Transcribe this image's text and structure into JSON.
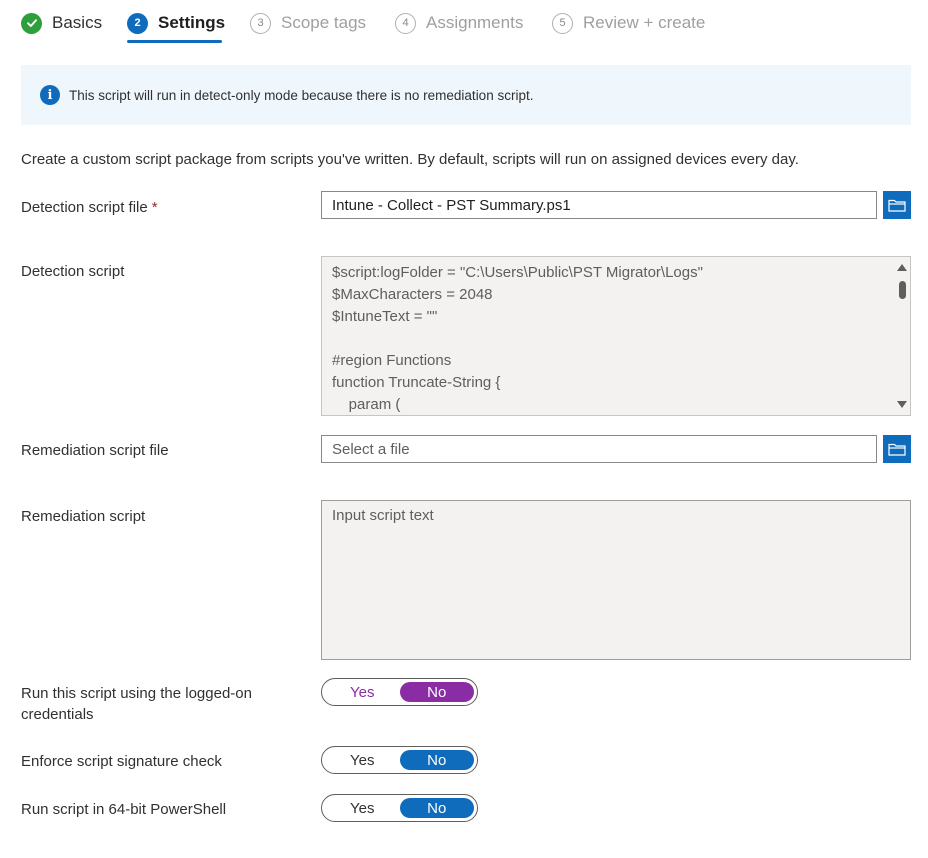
{
  "wizard": {
    "steps": [
      {
        "number": "✓",
        "label": "Basics",
        "state": "done"
      },
      {
        "number": "2",
        "label": "Settings",
        "state": "current"
      },
      {
        "number": "3",
        "label": "Scope tags",
        "state": "pending"
      },
      {
        "number": "4",
        "label": "Assignments",
        "state": "pending"
      },
      {
        "number": "5",
        "label": "Review + create",
        "state": "pending"
      }
    ]
  },
  "banner": {
    "icon": "info-icon",
    "icon_glyph": "i",
    "text": "This script will run in detect-only mode because there is no remediation script."
  },
  "description": "Create a custom script package from scripts you've written. By default, scripts will run on assigned devices every day.",
  "detection_file": {
    "label": "Detection script file",
    "required_marker": "*",
    "value": "Intune - Collect - PST Summary.ps1",
    "browse_icon": "folder-icon"
  },
  "detection_script": {
    "label": "Detection script",
    "lines": [
      "$script:logFolder = \"C:\\Users\\Public\\PST Migrator\\Logs\"",
      "$MaxCharacters = 2048",
      "$IntuneText = \"\"",
      "",
      "#region Functions",
      "function Truncate-String {",
      "    param ("
    ]
  },
  "remediation_file": {
    "label": "Remediation script file",
    "placeholder": "Select a file",
    "browse_icon": "folder-icon"
  },
  "remediation_script": {
    "label": "Remediation script",
    "placeholder": "Input script text"
  },
  "toggles": [
    {
      "label_line1": "Run this script using the logged-on",
      "label_line2": "credentials",
      "yes": "Yes",
      "no": "No",
      "selected": "No",
      "accent": "#8a2da5"
    },
    {
      "label_line1": "Enforce script signature check",
      "yes": "Yes",
      "no": "No",
      "selected": "No",
      "accent": "#0f6cbd"
    },
    {
      "label_line1": "Run script in 64-bit PowerShell",
      "yes": "Yes",
      "no": "No",
      "selected": "No",
      "accent": "#0f6cbd"
    }
  ],
  "colors": {
    "primary": "#0f6cbd",
    "success": "#2e9e3d",
    "required": "#a4262c",
    "banner_bg": "#eff6fc"
  }
}
